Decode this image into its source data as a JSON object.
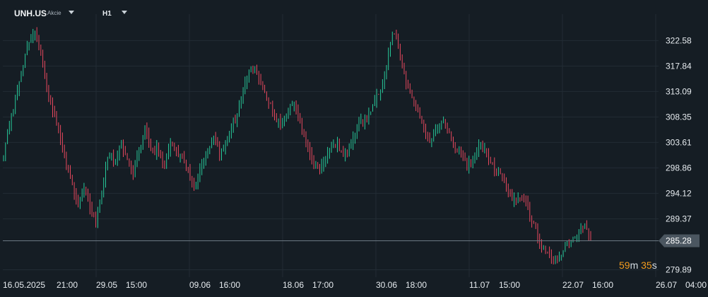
{
  "header": {
    "symbol": "UNH.US",
    "symbol_type": "Akcie",
    "timeframe": "H1"
  },
  "countdown": {
    "minutes": "59",
    "minutes_unit": "m",
    "seconds": "35",
    "seconds_unit": "s"
  },
  "colors": {
    "background": "#151d24",
    "grid": "#222c34",
    "up": "#27c99a",
    "down": "#e8485e",
    "current_line": "#6b7882",
    "current_tag_bg": "#4b5660",
    "countdown": "#f29c1f"
  },
  "chart_data": {
    "type": "candlestick",
    "ylim": [
      278.5,
      327.5
    ],
    "y_ticks": [
      "322.58",
      "317.84",
      "313.09",
      "308.35",
      "303.61",
      "298.86",
      "294.12",
      "289.37",
      "279.89"
    ],
    "x_ticks": [
      "16.05.2025",
      "21:00",
      "29.05",
      "15:00",
      "09.06",
      "16:00",
      "18.06",
      "17:00",
      "30.06",
      "18:00",
      "11.07",
      "15:00",
      "22.07",
      "16:00",
      "26.07",
      "04:00"
    ],
    "current_price": "285.28",
    "grid": true,
    "close_path": [
      301.5,
      307.5,
      312,
      317.5,
      322,
      324.5,
      320.5,
      313.5,
      309.5,
      305.5,
      300.5,
      296,
      291.5,
      295.5,
      291.5,
      289,
      295.5,
      301.5,
      299.5,
      303.5,
      300.5,
      297.5,
      302.5,
      306.5,
      301.5,
      302.5,
      299.5,
      303.5,
      301.5,
      300.5,
      297.5,
      295,
      299.5,
      302.5,
      304.5,
      301.5,
      303.5,
      306.5,
      309.5,
      314.5,
      317.5,
      316.5,
      313.5,
      311,
      307.5,
      307.5,
      309.5,
      310.5,
      307.5,
      303.5,
      300.5,
      298.5,
      300.5,
      302.5,
      303.5,
      300.5,
      302.5,
      305.5,
      307.5,
      308.5,
      311.5,
      313.5,
      317.5,
      324.5,
      320.5,
      315.5,
      312.5,
      309.5,
      306.5,
      303.5,
      306.5,
      307.5,
      305.5,
      302.5,
      301.5,
      299.5,
      300.5,
      303.5,
      301.5,
      299.5,
      298.5,
      296.5,
      293.5,
      292.5,
      293.5,
      290.5,
      287.5,
      284.5,
      282.5,
      281.5,
      282.5,
      284.5,
      285.5,
      286.5,
      288.5,
      285.3
    ]
  }
}
